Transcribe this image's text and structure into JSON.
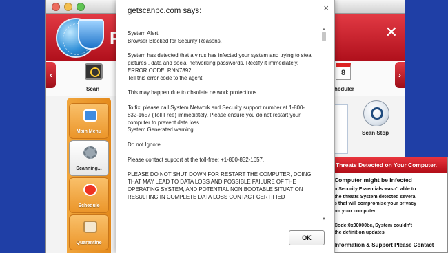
{
  "dialog": {
    "title": "getscanpc.com says:",
    "close_glyph": "×",
    "ok_label": "OK",
    "message": "System Alert.\n Browser Blocked for Security Reasons.\n\nSystem has detected that a virus has infected your system and trying to steal pictures , data and social networking passwords. Rectify it immediately.\n ERROR CODE: RNN7892\n Tell this error code to the agent.\n\n This may happen due to obsolete network protections.\n\n To fix, please call System Network and Security support number at 1-800-832-1657 (Toll Free) immediately. Please ensure you do not restart your computer to prevent data loss.\n System Generated warning.\n\nDo not Ignore.\n\nPlease contact support at the toll-free: +1-800-832-1657.\n\nPLEASE DO NOT SHUT DOWN FOR RESTART THE COMPUTER, DOING THAT MAY LEAD TO DATA LOSS AND POSSIBLE FAILURE OF THE OPERATING SYSTEM, AND POTENTIAL NON BOOTABLE SITUATION RESULTING IN COMPLETE DATA LOSS CONTACT CERTIFIED"
  },
  "background_app": {
    "brand_letter": "P",
    "scan_label": "Scan",
    "scheduler_label": "heduler",
    "scan_stop_label": "Scan Stop",
    "calendar_day": "8",
    "nav_left": "‹",
    "nav_right": "›",
    "sidebar": [
      {
        "label": "Main Menu",
        "icon": "home-icon"
      },
      {
        "label": "Scanning...",
        "icon": "gear-icon"
      },
      {
        "label": "Schedule",
        "icon": "alarm-clock-icon"
      },
      {
        "label": "Quarantine",
        "icon": "quarantine-icon"
      }
    ]
  },
  "threat_popup": {
    "header": "Threats Detected on Your Computer.",
    "title": "Computer might be infected",
    "lines": [
      "n Security Essentials wasn't able to",
      "the threats System detected several",
      "s that will compromise your privacy",
      "rm your computer.",
      "",
      "Code:0x00000bc, System couldn't",
      "the definition updates"
    ],
    "footer": "Information & Support Please Contact"
  },
  "colors": {
    "desktop_blue": "#1f3fa6",
    "brand_red": "#c81e2a",
    "sidebar_orange": "#e8921f"
  }
}
